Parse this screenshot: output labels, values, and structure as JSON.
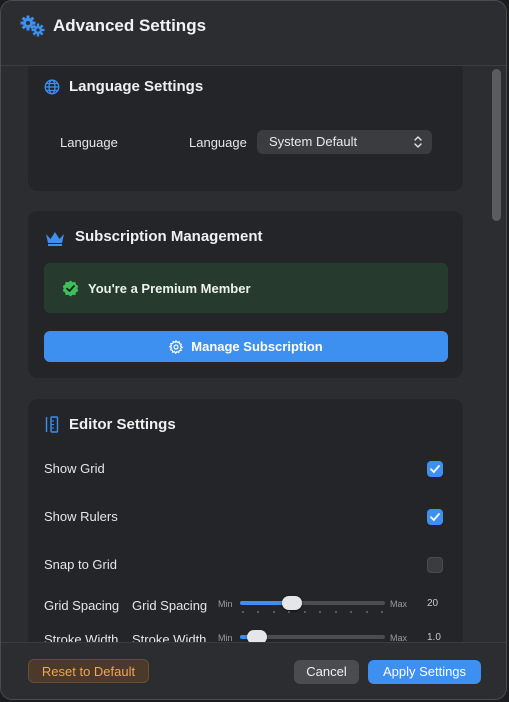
{
  "window": {
    "title": "Advanced Settings"
  },
  "language_section": {
    "title": "Language Settings",
    "row_label": "Language",
    "field_label": "Language",
    "selected": "System Default"
  },
  "subscription_section": {
    "title": "Subscription Management",
    "status": "You're a Premium Member",
    "manage_button": "Manage Subscription"
  },
  "editor_section": {
    "title": "Editor Settings",
    "show_grid": {
      "label": "Show Grid",
      "checked": true
    },
    "show_rulers": {
      "label": "Show Rulers",
      "checked": true
    },
    "snap_to_grid": {
      "label": "Snap to Grid",
      "checked": false
    },
    "grid_spacing": {
      "label": "Grid Spacing",
      "field_label": "Grid Spacing",
      "min_label": "Min",
      "max_label": "Max",
      "value": "20",
      "level": 0.36
    },
    "stroke_width": {
      "label": "Stroke Width",
      "field_label": "Stroke Width",
      "min_label": "Min",
      "max_label": "Max",
      "value": "1.0",
      "level": 0.12
    }
  },
  "footer": {
    "reset": "Reset to Default",
    "cancel": "Cancel",
    "apply": "Apply Settings"
  },
  "colors": {
    "accent": "#3d8ff0",
    "success_bg": "#263a2e",
    "warning_text": "#f0a458"
  }
}
